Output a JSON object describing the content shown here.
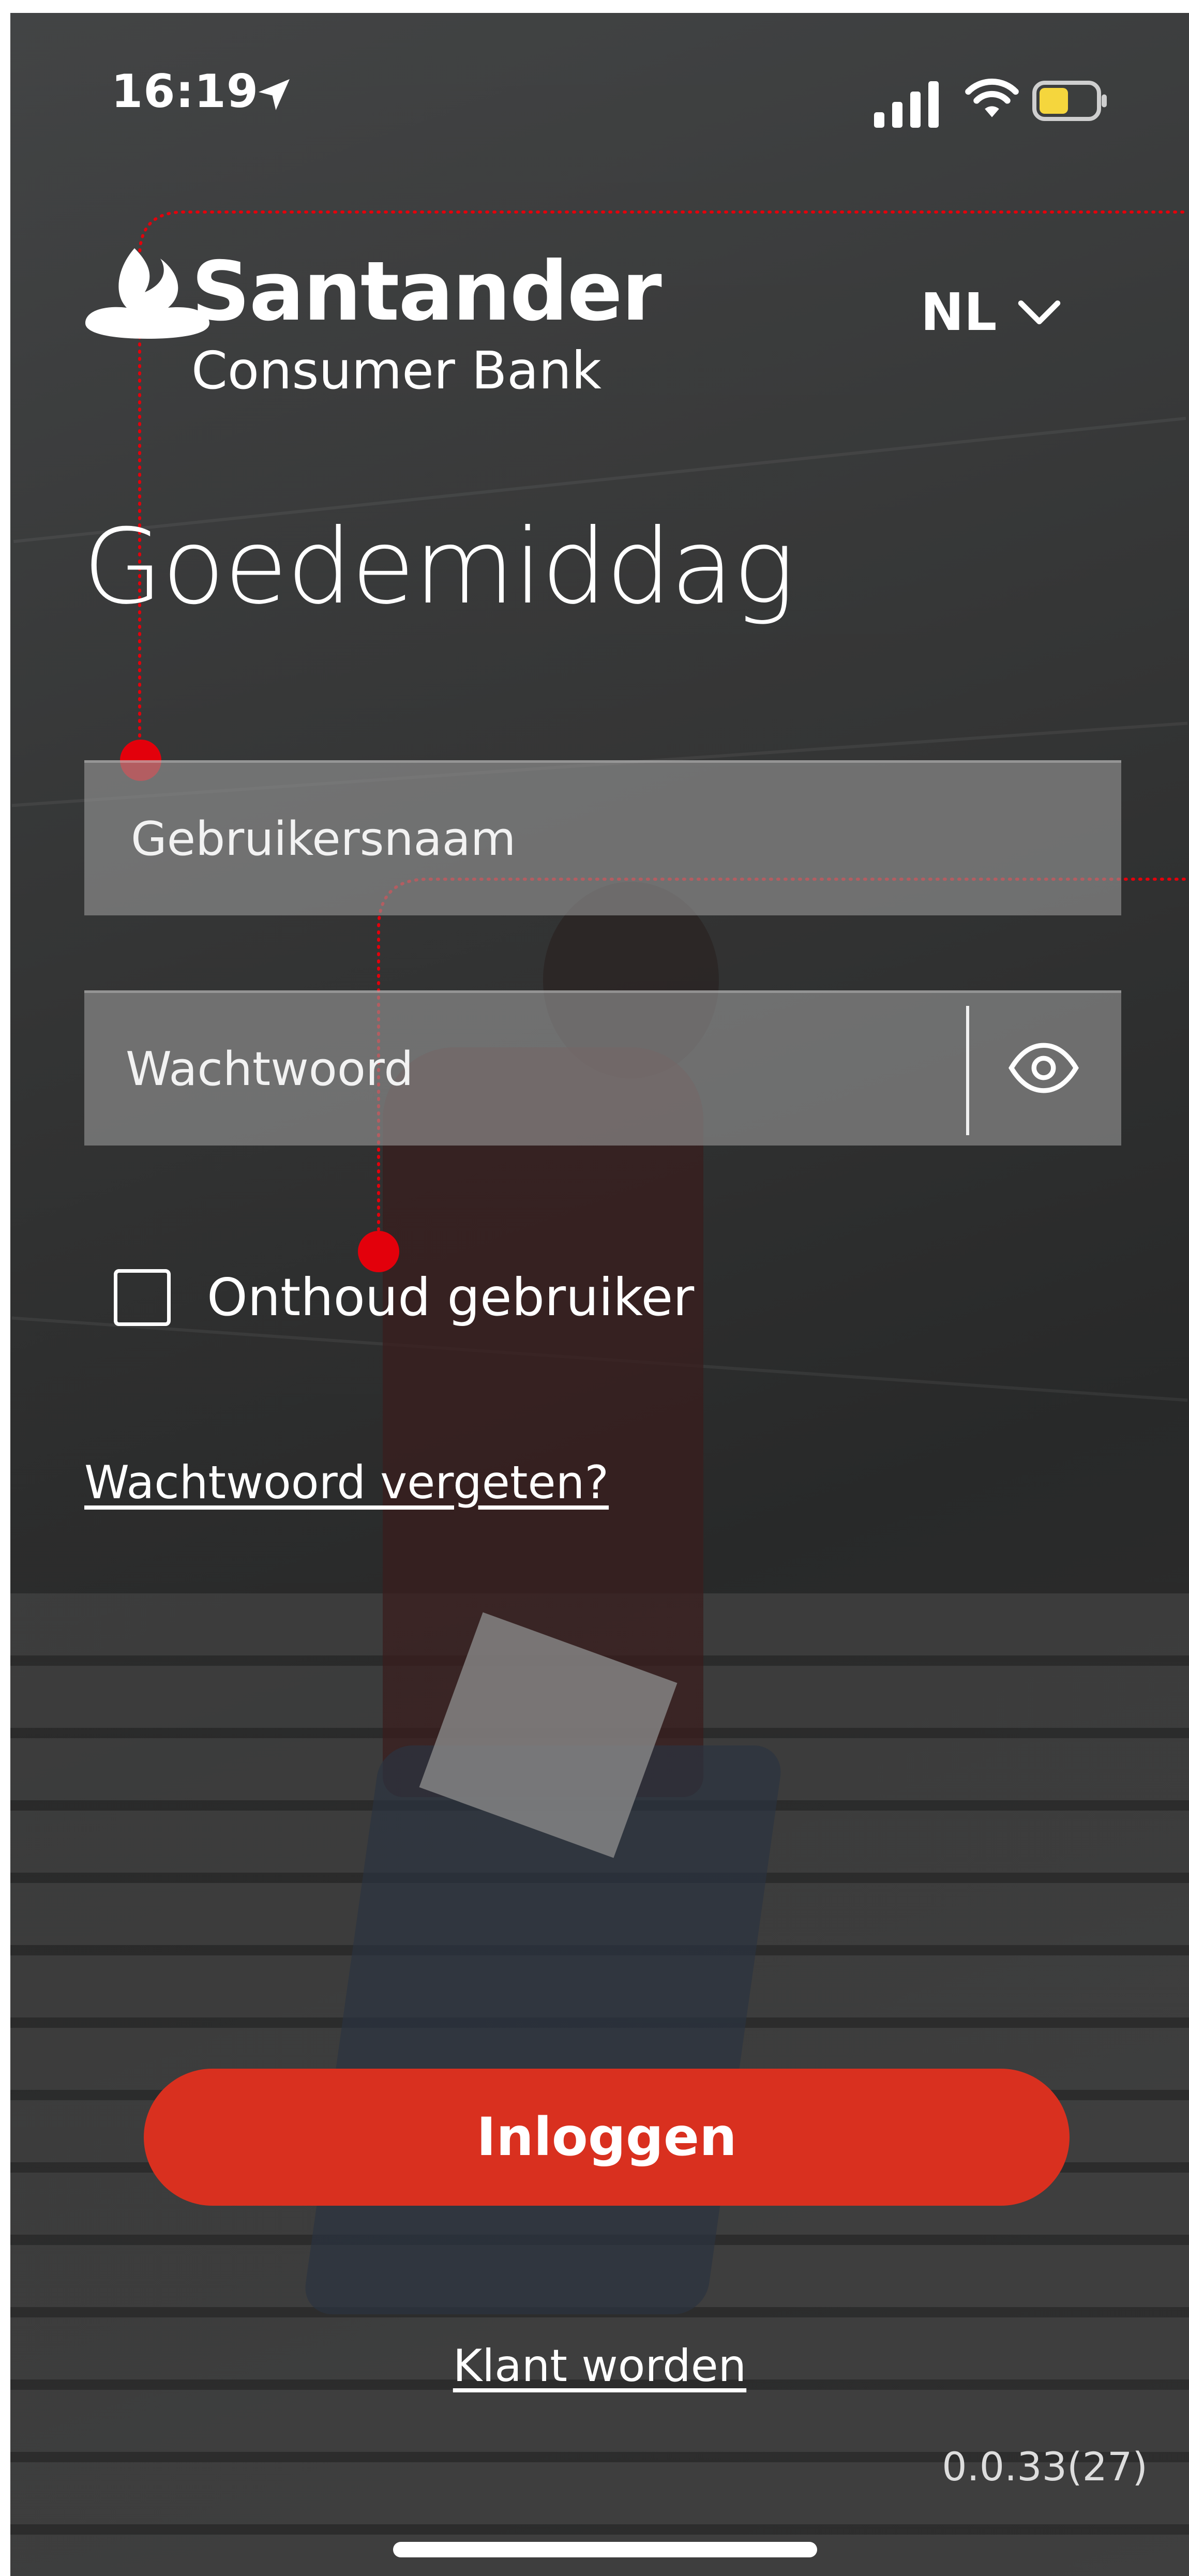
{
  "status_bar": {
    "time": "16:19",
    "location_icon": "location-arrow-icon",
    "signal_icon": "cellular-signal-icon",
    "wifi_icon": "wifi-icon",
    "battery_icon": "battery-icon",
    "battery_color": "#f5d63d"
  },
  "header": {
    "brand_name": "Santander",
    "brand_subtitle": "Consumer Bank",
    "logo_icon": "santander-flame-icon",
    "language": "NL",
    "language_icon": "chevron-down-icon"
  },
  "greeting": "Goedemiddag",
  "form": {
    "username_placeholder": "Gebruikersnaam",
    "password_placeholder": "Wachtwoord",
    "show_password_icon": "eye-icon",
    "remember_label": "Onthoud gebruiker",
    "remember_checked": false,
    "forgot_link": "Wachtwoord vergeten?",
    "login_button": "Inloggen"
  },
  "footer": {
    "register_link": "Klant worden",
    "version": "0.0.33(27)"
  },
  "colors": {
    "brand_red": "#d9301f",
    "guide_red": "#e3000b"
  }
}
